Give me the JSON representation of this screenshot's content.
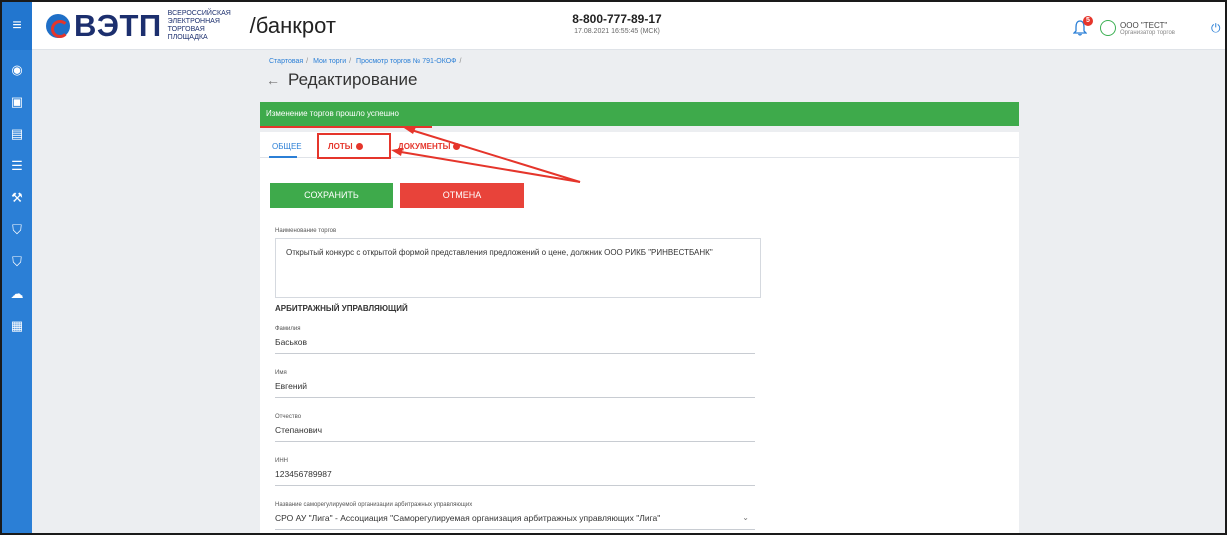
{
  "header": {
    "logo_text": "ВЭТП",
    "logo_sub": "Всероссийская электронная торговая площадка",
    "logo_suffix": "/банкрот",
    "phone": "8-800-777-89-17",
    "datetime": "17.08.2021 16:55:45 (МСК)",
    "notifications_count": "5",
    "user_name": "ООО \"ТЕСТ\"",
    "user_role": "Организатор торгов"
  },
  "breadcrumbs": [
    "Стартовая",
    "Мои торги",
    "Просмотр торгов № 791-ОКОФ"
  ],
  "page_title": "Редактирование",
  "alert_text": "Изменение торгов прошло успешно",
  "tabs": [
    {
      "label": "Общее"
    },
    {
      "label": "Лоты"
    },
    {
      "label": "Документы"
    }
  ],
  "buttons": {
    "save": "Сохранить",
    "cancel": "Отмена"
  },
  "form": {
    "name_label": "Наименование торгов",
    "name_value": "Открытый конкурс с открытой формой представления предложений о цене, должник ООО РИКБ \"РИНВЕСТБАНК\"",
    "section_title": "Арбитражный управляющий",
    "lastname_label": "Фамилия",
    "lastname_value": "Баськов",
    "firstname_label": "Имя",
    "firstname_value": "Евгений",
    "patronymic_label": "Отчество",
    "patronymic_value": "Степанович",
    "inn_label": "ИНН",
    "inn_value": "123456789987",
    "sro_label": "Название саморегулируемой организации арбитражных управляющих",
    "sro_value": "СРО АУ \"Лига\" - Ассоциация \"Саморегулируемая организация арбитражных управляющих \"Лига\""
  }
}
